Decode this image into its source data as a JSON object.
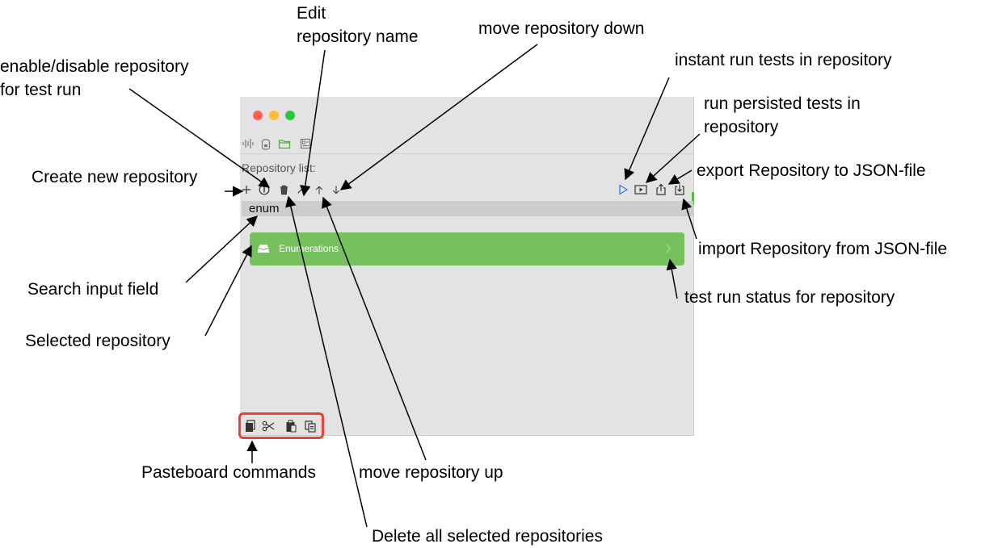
{
  "window": {
    "traffic_lights": [
      "#ff5f57",
      "#febc2e",
      "#28c840"
    ],
    "toolbar_icons": [
      "waveform-icon",
      "jar-icon",
      "folder-icon",
      "report-icon"
    ],
    "repository_list_label": "Repository list:",
    "search_value": "enum",
    "repositories": [
      {
        "name": "Enumerations",
        "icon": "tray-icon",
        "selected": true,
        "status_icon": "chevron-right-icon"
      }
    ],
    "left_controls": [
      "plus-icon",
      "toggle-icon",
      "trash-icon",
      "pencil-icon",
      "arrow-up-icon",
      "arrow-down-icon"
    ],
    "right_controls": [
      "play-icon",
      "play-rect-icon",
      "share-out-icon",
      "import-icon"
    ],
    "pasteboard_icons": [
      "copy-icon",
      "scissors-icon",
      "paste-icon",
      "duplicate-icon"
    ],
    "accent": "#76c05e",
    "highlight_box_color": "#e8413a"
  },
  "annotations": {
    "edit_l1": "Edit",
    "edit_l2": "repository name",
    "move_down": "move repository down",
    "enable_l1": "enable/disable repository",
    "enable_l2": "for test run",
    "instant_run": "instant run tests in repository",
    "persisted_l1": "run persisted tests in",
    "persisted_l2": "repository",
    "create": "Create new repository",
    "export": "export Repository to JSON-file",
    "import": "import Repository from JSON-file",
    "search": "Search input field",
    "status": "test run status for repository",
    "selected": "Selected repository",
    "pasteboard": "Pasteboard commands",
    "move_up": "move repository up",
    "delete": "Delete all selected repositories"
  }
}
